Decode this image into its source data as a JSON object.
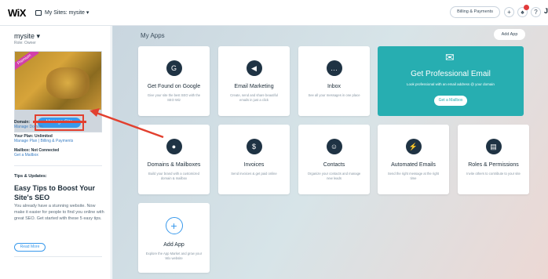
{
  "topbar": {
    "logo": "WiX",
    "sites_label": "My Sites: mysite ▾",
    "billing_label": "Billing & Payments",
    "plus": "+",
    "question": "?",
    "avatar": "J"
  },
  "sidebar": {
    "site_name": "mysite ▾",
    "role": "Role: Owner",
    "ribbon": "Premium",
    "manage_label": "Manage Site",
    "domain_label": "Domain:",
    "domain_link": "Manage Domain",
    "plan_label": "Your Plan: Unlimited",
    "plan_links": "Manage Plan | Billing & Payments",
    "mailbox_label": "Mailbox: Not Connected",
    "mailbox_link": "Get a Mailbox",
    "tips_heading": "Tips & Updates:",
    "tips_title": "Easy Tips to Boost Your Site's SEO",
    "tips_body": "You already have a stunning website. Now make it easier for people to find you online with great SEO. Get started with these 5 easy tips.",
    "read_more": "Read More"
  },
  "main": {
    "heading": "My Apps",
    "add_app_label": "Add App",
    "apps": [
      {
        "title": "Get Found on Google",
        "desc": "Give your site the best SEO with the SEO Wiz",
        "icon": "google-icon",
        "glyph": "G"
      },
      {
        "title": "Email Marketing",
        "desc": "Create, send and share beautiful emails in just a click",
        "icon": "megaphone-icon",
        "glyph": "◀"
      },
      {
        "title": "Inbox",
        "desc": "See all your messages in one place",
        "icon": "chat-icon",
        "glyph": "…"
      },
      {
        "title": "Domains & Mailboxes",
        "desc": "Build your brand with a customized domain & mailbox",
        "icon": "location-icon",
        "glyph": "●"
      },
      {
        "title": "Invoices",
        "desc": "Send invoices & get paid online",
        "icon": "invoice-icon",
        "glyph": "$"
      },
      {
        "title": "Contacts",
        "desc": "Organize your contacts and manage new leads",
        "icon": "person-icon",
        "glyph": "☺"
      },
      {
        "title": "Automated Emails",
        "desc": "Send the right message at the right time",
        "icon": "lightning-icon",
        "glyph": "⚡"
      },
      {
        "title": "Roles & Permissions",
        "desc": "Invite others to contribute to your site",
        "icon": "id-card-icon",
        "glyph": "▤"
      }
    ],
    "email_card": {
      "title": "Get Professional Email",
      "desc": "Look professional with an email address @ your domain",
      "button": "Get a Mailbox",
      "icon": "envelope-icon",
      "glyph": "✉"
    },
    "add_card": {
      "title": "Add App",
      "desc": "Explore the App Market and grow your Wix website",
      "glyph": "+"
    }
  }
}
